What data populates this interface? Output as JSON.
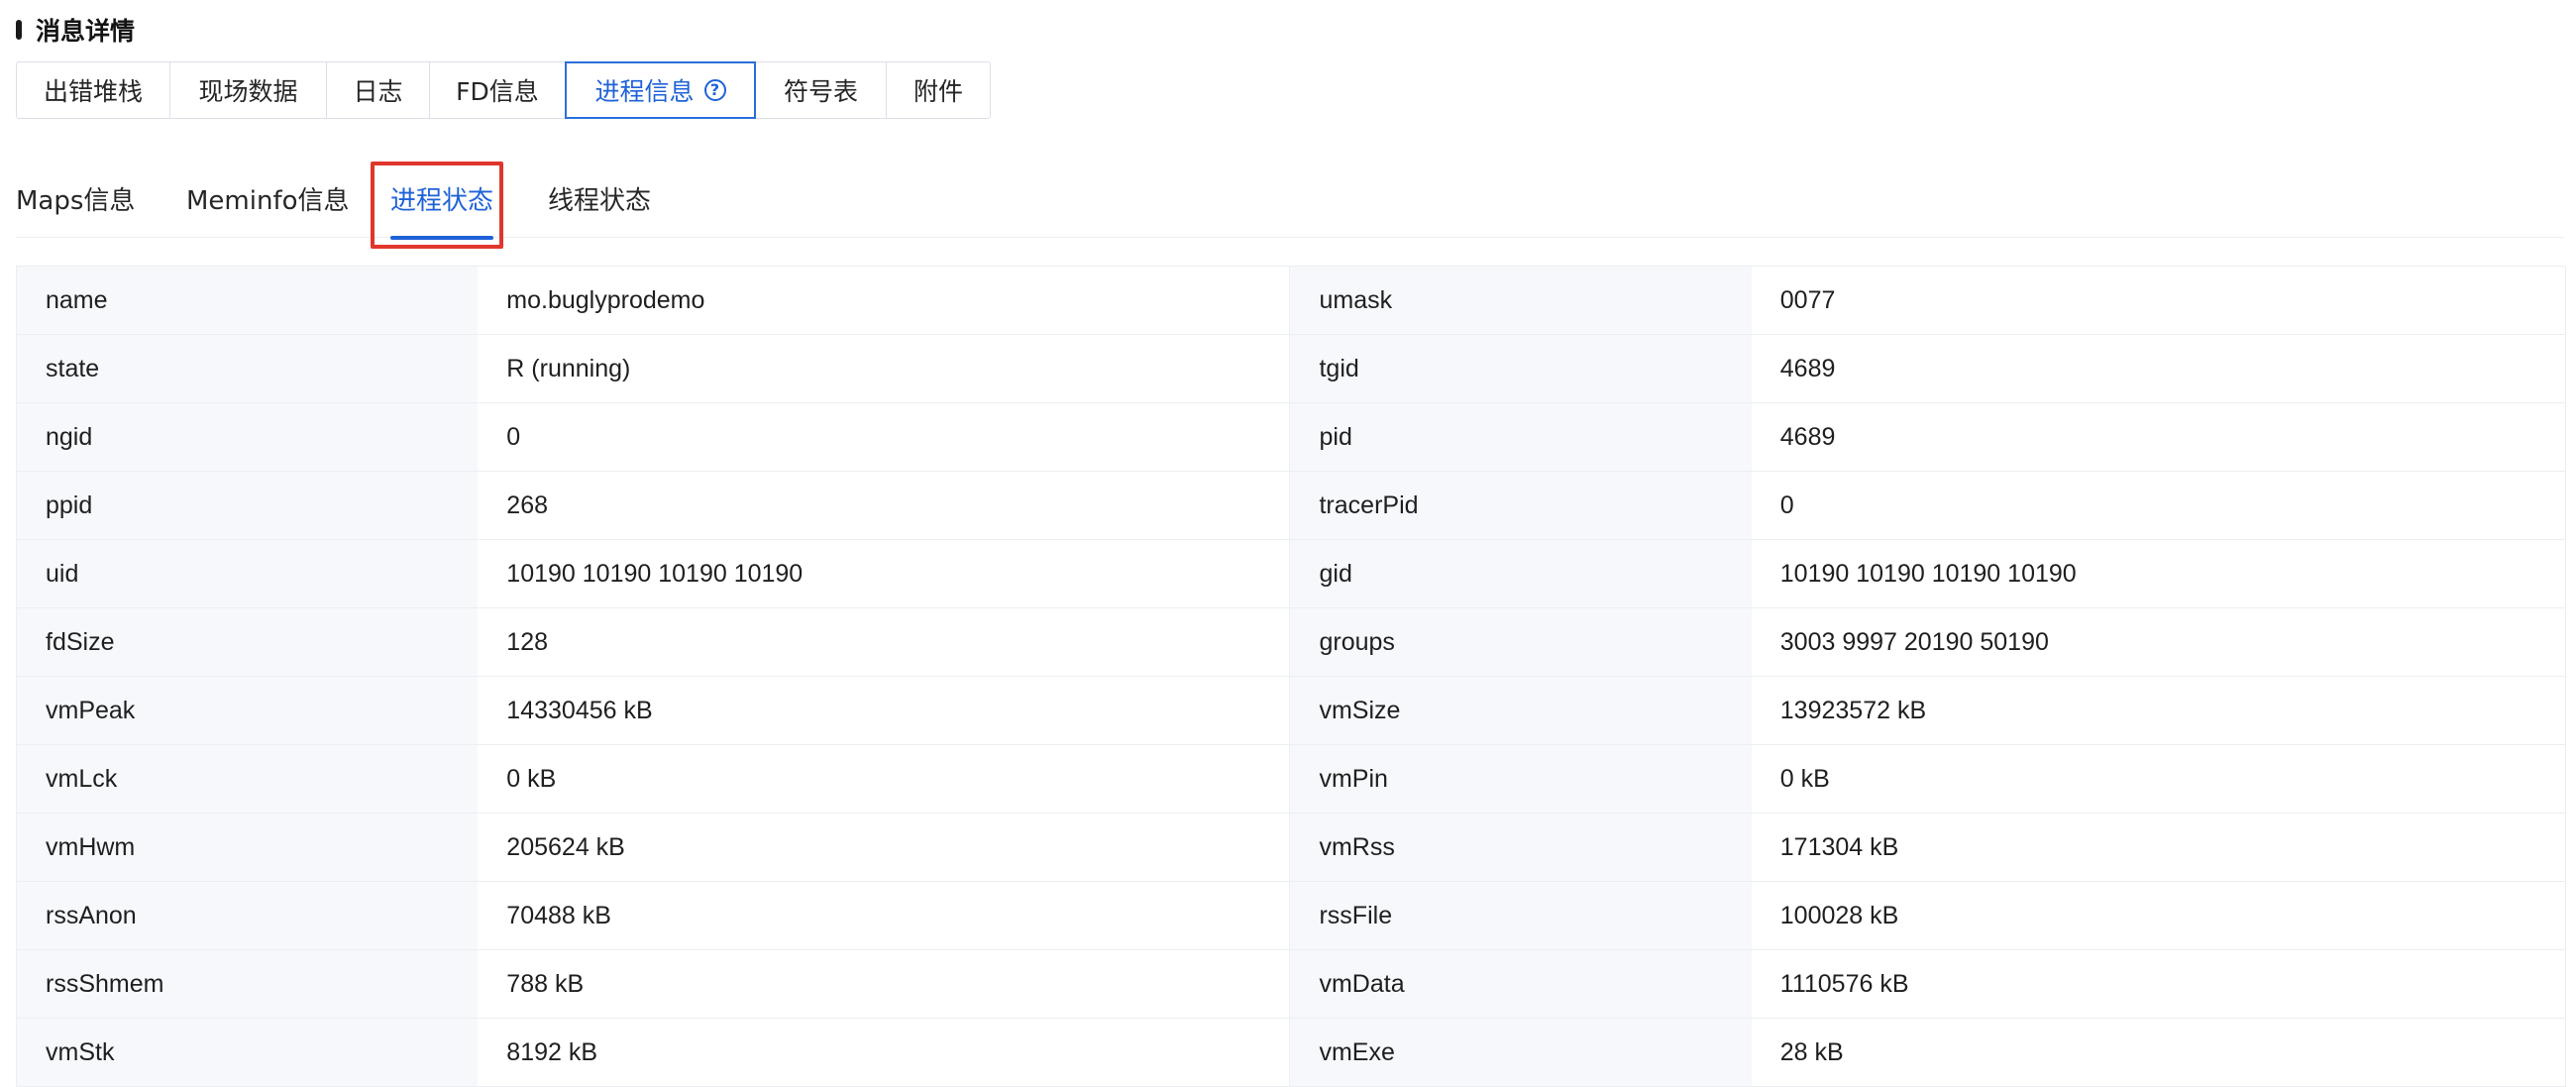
{
  "section": {
    "title": "消息详情"
  },
  "top_tabs": [
    {
      "label": "出错堆栈",
      "active": false
    },
    {
      "label": "现场数据",
      "active": false
    },
    {
      "label": "日志",
      "active": false
    },
    {
      "label": "FD信息",
      "active": false
    },
    {
      "label": "进程信息",
      "active": true,
      "icon": "help-circle-icon",
      "icon_glyph": "?"
    },
    {
      "label": "符号表",
      "active": false
    },
    {
      "label": "附件",
      "active": false
    }
  ],
  "sub_tabs": [
    {
      "label": "Maps信息",
      "active": false
    },
    {
      "label": "Meminfo信息",
      "active": false
    },
    {
      "label": "进程状态",
      "active": true
    },
    {
      "label": "线程状态",
      "active": false
    }
  ],
  "rows": [
    {
      "k1": "name",
      "v1": "mo.buglyprodemo",
      "k2": "umask",
      "v2": "0077"
    },
    {
      "k1": "state",
      "v1": "R (running)",
      "k2": "tgid",
      "v2": "4689"
    },
    {
      "k1": "ngid",
      "v1": "0",
      "k2": "pid",
      "v2": "4689"
    },
    {
      "k1": "ppid",
      "v1": "268",
      "k2": "tracerPid",
      "v2": "0"
    },
    {
      "k1": "uid",
      "v1": "10190 10190 10190 10190",
      "k2": "gid",
      "v2": "10190 10190 10190 10190"
    },
    {
      "k1": "fdSize",
      "v1": "128",
      "k2": "groups",
      "v2": "3003 9997 20190 50190"
    },
    {
      "k1": "vmPeak",
      "v1": "14330456 kB",
      "k2": "vmSize",
      "v2": "13923572 kB"
    },
    {
      "k1": "vmLck",
      "v1": "0 kB",
      "k2": "vmPin",
      "v2": "0 kB"
    },
    {
      "k1": "vmHwm",
      "v1": "205624 kB",
      "k2": "vmRss",
      "v2": "171304 kB"
    },
    {
      "k1": "rssAnon",
      "v1": "70488 kB",
      "k2": "rssFile",
      "v2": "100028 kB"
    },
    {
      "k1": "rssShmem",
      "v1": "788 kB",
      "k2": "vmData",
      "v2": "1110576 kB"
    },
    {
      "k1": "vmStk",
      "v1": "8192 kB",
      "k2": "vmExe",
      "v2": "28 kB"
    }
  ],
  "colors": {
    "accent": "#1f62d8",
    "highlight": "#e0362c",
    "key_bg": "#f6f8fb",
    "border": "#eceef2"
  }
}
